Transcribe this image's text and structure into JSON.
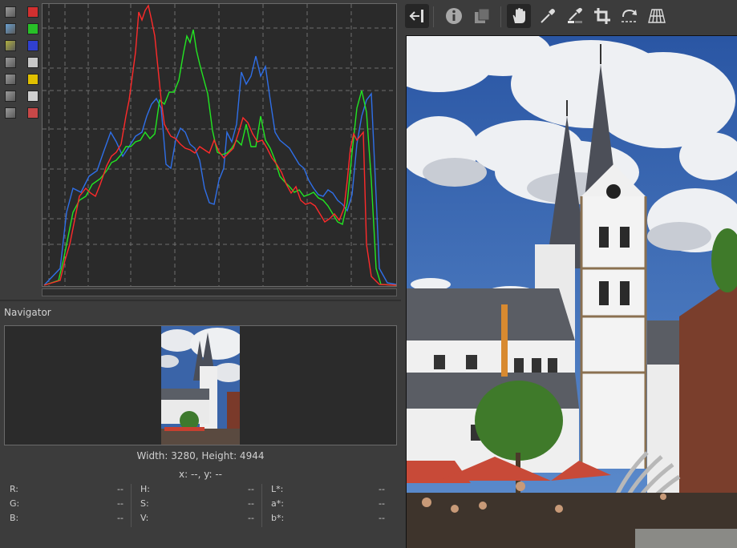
{
  "panels": {
    "navigator_title": "Navigator"
  },
  "image_info": {
    "dimensions": "Width: 3280, Height: 4944",
    "cursor": "x: --, y: --"
  },
  "readouts": {
    "rgb": [
      {
        "label": "R:",
        "value": "--"
      },
      {
        "label": "G:",
        "value": "--"
      },
      {
        "label": "B:",
        "value": "--"
      }
    ],
    "hsv": [
      {
        "label": "H:",
        "value": "--"
      },
      {
        "label": "S:",
        "value": "--"
      },
      {
        "label": "V:",
        "value": "--"
      }
    ],
    "lab": [
      {
        "label": "L*:",
        "value": "--"
      },
      {
        "label": "a*:",
        "value": "--"
      },
      {
        "label": "b*:",
        "value": "--"
      }
    ]
  },
  "histogram_tools": [
    {
      "name": "histogram-type-icon",
      "color": "#9a9a9a"
    },
    {
      "name": "red-channel-toggle",
      "color": "#d23030"
    },
    {
      "name": "raw-histogram-icon",
      "color": "#6aa0d0"
    },
    {
      "name": "green-channel-toggle",
      "color": "#28c028"
    },
    {
      "name": "chroma-icon",
      "color": "#b0b040"
    },
    {
      "name": "blue-channel-toggle",
      "color": "#3040d0"
    },
    {
      "name": "waveform-icon",
      "color": "#9a9a9a"
    },
    {
      "name": "luminance-toggle",
      "color": "#c8c8c8"
    },
    {
      "name": "vectorscope-icon",
      "color": "#9a9a9a"
    },
    {
      "name": "chromaticity-toggle",
      "color": "#e0c000"
    },
    {
      "name": "target-icon",
      "color": "#9a9a9a"
    },
    {
      "name": "log-scale-toggle",
      "color": "#d0d0d0"
    },
    {
      "name": "menu-icon",
      "color": "#9a9a9a"
    },
    {
      "name": "rgb-bar-toggle",
      "color": "#c84848"
    }
  ],
  "colors": {
    "red": "#ff2a2a",
    "green": "#22e622",
    "blue": "#2f6fe8",
    "yellow": "#e8d020",
    "grid": "#777777"
  },
  "toolbar_icons": [
    "hide-panel-icon",
    "info-icon",
    "before-after-icon",
    "hand-icon",
    "color-picker-icon",
    "white-balance-picker-icon",
    "crop-icon",
    "straighten-icon",
    "perspective-icon"
  ]
}
